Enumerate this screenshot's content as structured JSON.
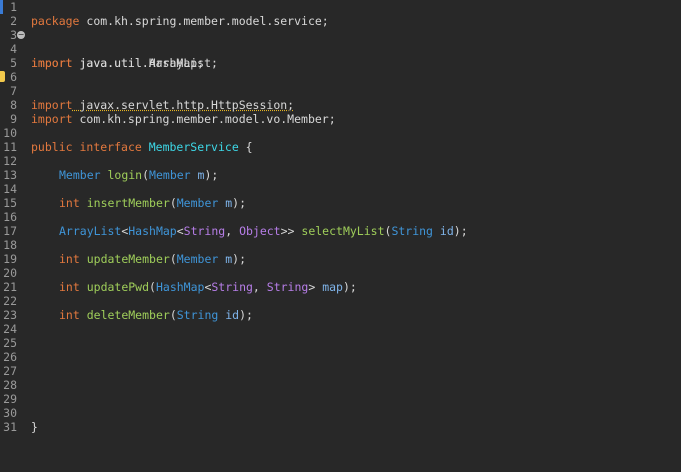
{
  "editor": {
    "line_numbers": [
      "1",
      "2",
      "3",
      "4",
      "5",
      "6",
      "7",
      "8",
      "9",
      "10",
      "11",
      "12",
      "13",
      "14",
      "15",
      "16",
      "17",
      "18",
      "19",
      "20",
      "21",
      "22",
      "23",
      "24",
      "25",
      "26",
      "27",
      "28",
      "29",
      "30",
      "31"
    ],
    "line1": {
      "kw": "package",
      "rest": " com.kh.spring.member.model.service;"
    },
    "line3": {
      "kw": "import",
      "rest": " java.util.ArrayList;"
    },
    "line4": {
      "kw": "import",
      "rest": " java.util.HashMap;"
    },
    "line6": {
      "kw": "import",
      "rest": " javax.servlet.http.HttpSession;"
    },
    "line8": {
      "kw": "import",
      "rest": " com.kh.spring.member.model.vo.Member;"
    },
    "line10": {
      "kw1": "public",
      "kw2": "interface",
      "name": "MemberService",
      "brace": " {"
    },
    "line12": {
      "type": "Member",
      "fn": "login",
      "p_open": "(",
      "ptype": "Member",
      "pname": "m",
      "p_close": ");"
    },
    "line14": {
      "kw": "int",
      "fn": "insertMember",
      "p_open": "(",
      "ptype": "Member",
      "pname": "m",
      "p_close": ");"
    },
    "line16": {
      "t1": "ArrayList",
      "lt1": "<",
      "t2": "HashMap",
      "lt2": "<",
      "t3": "String",
      "comma": ", ",
      "t4": "Object",
      "gt": ">>",
      "fn": "selectMyList",
      "p_open": "(",
      "ptype": "String",
      "pname": "id",
      "p_close": ");"
    },
    "line18": {
      "kw": "int",
      "fn": "updateMember",
      "p_open": "(",
      "ptype": "Member",
      "pname": "m",
      "p_close": ");"
    },
    "line20": {
      "kw": "int",
      "fn": "updatePwd",
      "p_open": "(",
      "t1": "HashMap",
      "lt": "<",
      "t2": "String",
      "comma": ", ",
      "t3": "String",
      "gt": ">",
      "pname": "map",
      "p_close": ");"
    },
    "line22": {
      "kw": "int",
      "fn": "deleteMember",
      "p_open": "(",
      "ptype": "String",
      "pname": "id",
      "p_close": ");"
    },
    "line30": {
      "brace": "}"
    },
    "fold_marker": "−"
  }
}
